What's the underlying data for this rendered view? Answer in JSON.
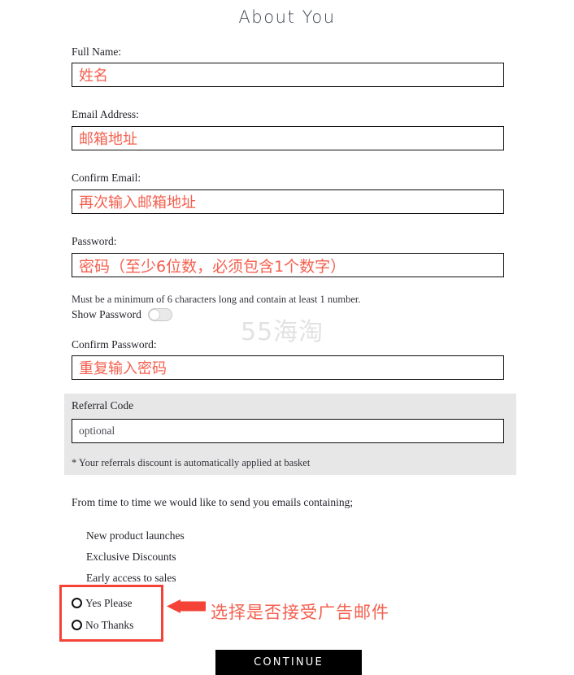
{
  "page": {
    "title": "About You",
    "watermark": "55海淘"
  },
  "fields": {
    "full_name": {
      "label": "Full Name:",
      "value": "姓名"
    },
    "email": {
      "label": "Email Address:",
      "value": "邮箱地址"
    },
    "confirm_email": {
      "label": "Confirm Email:",
      "value": "再次输入邮箱地址"
    },
    "password": {
      "label": "Password:",
      "value": "密码（至少6位数，必须包含1个数字）",
      "hint": "Must be a minimum of 6 characters long and contain at least 1 number.",
      "show_password_label": "Show Password",
      "show_password_state": "off"
    },
    "confirm_password": {
      "label": "Confirm Password:",
      "value": "重复输入密码"
    }
  },
  "referral": {
    "label": "Referral Code",
    "placeholder": "optional",
    "value": "optional",
    "note": "* Your referrals discount is automatically applied at basket"
  },
  "email_prefs": {
    "intro": "From time to time we would like to send you emails containing;",
    "items": [
      "New product launches",
      "Exclusive Discounts",
      "Early access to sales"
    ],
    "options": [
      {
        "label": "Yes Please",
        "selected": false
      },
      {
        "label": "No Thanks",
        "selected": false
      }
    ]
  },
  "annotation": {
    "text": "选择是否接受广告邮件",
    "color": "#f44336"
  },
  "actions": {
    "continue_label": "CONTINUE"
  }
}
